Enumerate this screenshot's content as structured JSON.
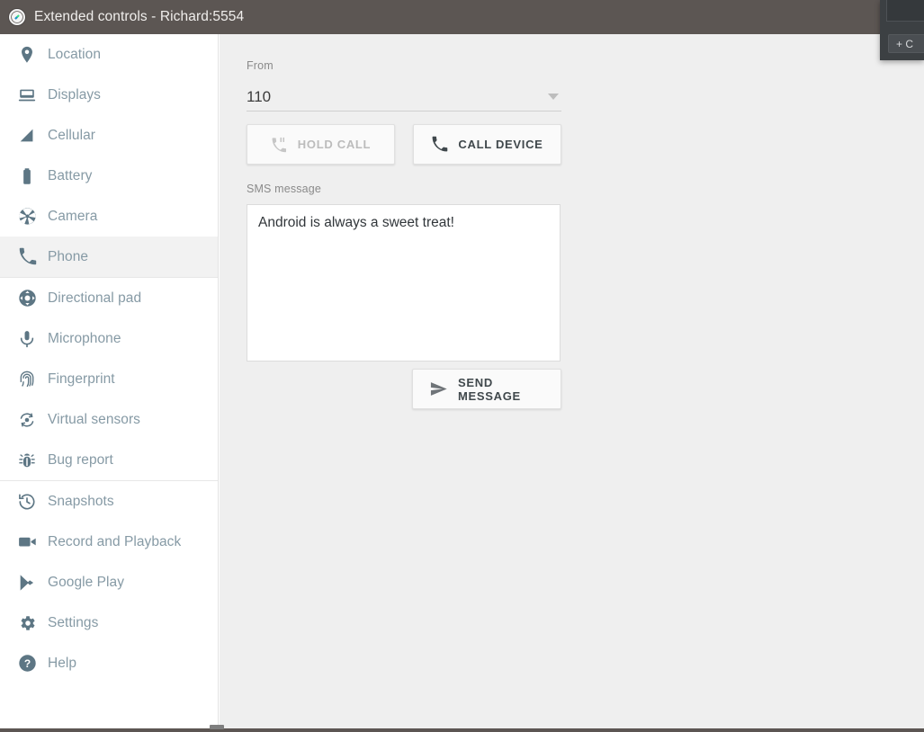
{
  "window": {
    "title": "Extended controls - Richard:5554",
    "app_icon": "emulator-icon",
    "titlebar_color": "#5c5653"
  },
  "right_panel": {
    "add_button_label": "+ C",
    "icon": "plus-icon",
    "panel_color": "#3c4043"
  },
  "sidebar": {
    "active_item": "Phone",
    "groups": [
      {
        "items": [
          {
            "label": "Location",
            "icon": "location-pin-icon"
          },
          {
            "label": "Displays",
            "icon": "display-monitor-icon"
          },
          {
            "label": "Cellular",
            "icon": "signal-bars-icon"
          },
          {
            "label": "Battery",
            "icon": "battery-icon"
          },
          {
            "label": "Camera",
            "icon": "camera-aperture-icon"
          },
          {
            "label": "Phone",
            "icon": "phone-handset-icon"
          }
        ]
      },
      {
        "items": [
          {
            "label": "Directional pad",
            "icon": "directional-pad-icon"
          },
          {
            "label": "Microphone",
            "icon": "microphone-icon"
          },
          {
            "label": "Fingerprint",
            "icon": "fingerprint-icon"
          },
          {
            "label": "Virtual sensors",
            "icon": "virtual-sensors-icon"
          },
          {
            "label": "Bug report",
            "icon": "bug-icon"
          }
        ]
      },
      {
        "items": [
          {
            "label": "Snapshots",
            "icon": "history-clock-icon"
          },
          {
            "label": "Record and Playback",
            "icon": "video-camera-icon"
          },
          {
            "label": "Google Play",
            "icon": "google-play-icon"
          },
          {
            "label": "Settings",
            "icon": "gear-icon"
          },
          {
            "label": "Help",
            "icon": "question-mark-circle-icon"
          }
        ]
      }
    ]
  },
  "main": {
    "from": {
      "label": "From",
      "value": "110",
      "dropdown_icon": "chevron-down-icon"
    },
    "actions": {
      "hold_call": {
        "label": "HOLD CALL",
        "icon": "phone-pause-icon",
        "disabled": true
      },
      "call_device": {
        "label": "CALL DEVICE",
        "icon": "phone-handset-icon",
        "disabled": false
      }
    },
    "sms": {
      "label": "SMS message",
      "value": "Android is always a sweet treat!",
      "placeholder": ""
    },
    "send": {
      "label": "SEND MESSAGE",
      "icon": "send-paper-plane-icon"
    }
  },
  "colors": {
    "sidebar_text": "#869aa5",
    "content_background": "#efefef",
    "active_item_background": "#f2f2f2",
    "button_text": "#40484c",
    "disabled_text": "#bcbcbc"
  }
}
